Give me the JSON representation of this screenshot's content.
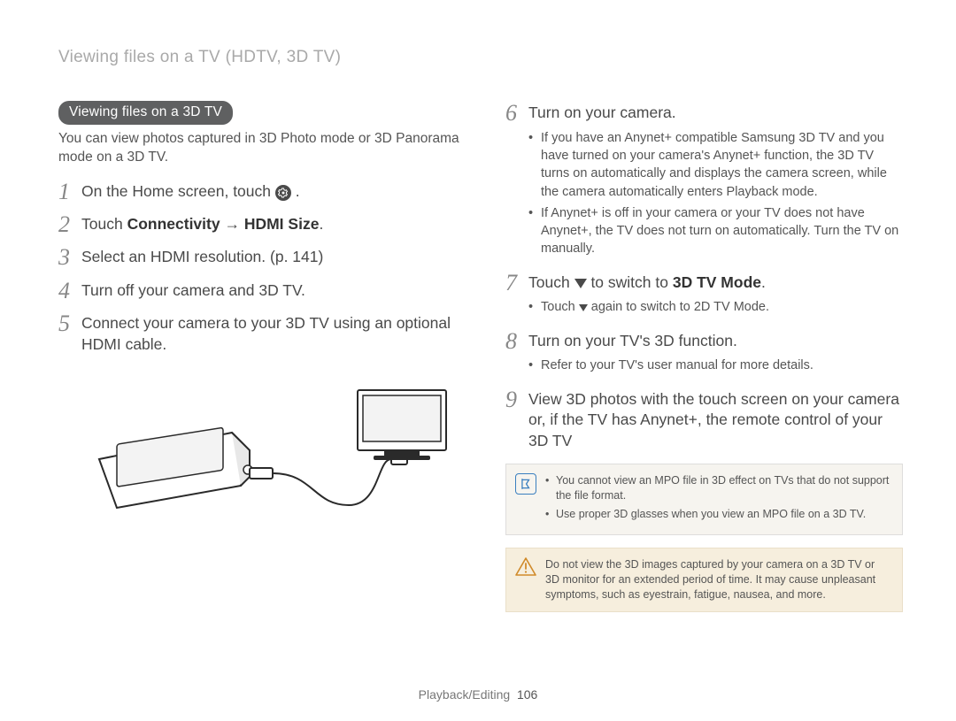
{
  "breadcrumb": "Viewing files on a TV (HDTV, 3D TV)",
  "section_pill": "Viewing files on a 3D TV",
  "intro": "You can view photos captured in 3D Photo mode or 3D Panorama mode on a 3D TV.",
  "left_steps": {
    "s1": {
      "num": "1",
      "text_pre": "On the Home screen, touch ",
      "text_post": " ."
    },
    "s2": {
      "num": "2",
      "text_pre": "Touch ",
      "b1": "Connectivity",
      "arrow": " → ",
      "b2": "HDMI Size",
      "text_post": "."
    },
    "s3": {
      "num": "3",
      "text": "Select an HDMI resolution. (p. 141)"
    },
    "s4": {
      "num": "4",
      "text": "Turn off your camera and 3D TV."
    },
    "s5": {
      "num": "5",
      "text": "Connect your camera to your 3D TV using an optional HDMI cable."
    }
  },
  "right_steps": {
    "s6": {
      "num": "6",
      "text": "Turn on your camera.",
      "sub": [
        "If you have an Anynet+ compatible Samsung 3D TV and you have turned on your camera's Anynet+ function, the 3D TV turns on automatically and displays the camera screen, while the camera automatically enters Playback mode.",
        "If Anynet+ is off in your camera or your TV does not have Anynet+, the TV does not turn on automatically. Turn the TV on manually."
      ]
    },
    "s7": {
      "num": "7",
      "text_pre": "Touch ",
      "text_mid": " to switch to ",
      "b1": "3D TV Mode",
      "text_post": ".",
      "sub_pre": "Touch ",
      "sub_mid": " again to switch to ",
      "sub_b": "2D TV Mode",
      "sub_post": "."
    },
    "s8": {
      "num": "8",
      "text": "Turn on your TV's 3D function.",
      "sub": [
        "Refer to your TV's user manual for more details."
      ]
    },
    "s9": {
      "num": "9",
      "text": "View 3D photos with the touch screen on your camera or, if the TV has Anynet+, the remote control of your 3D TV"
    }
  },
  "note_items": [
    "You cannot view an MPO file in 3D effect on TVs that do not support the file format.",
    "Use proper 3D glasses when you view an MPO file on a 3D TV."
  ],
  "warn_text": "Do not view the 3D images captured by your camera on a 3D TV or 3D monitor for an extended period of time. It may cause unpleasant symptoms, such as eyestrain, fatigue, nausea, and more.",
  "footer_section": "Playback/Editing",
  "footer_page": "106"
}
